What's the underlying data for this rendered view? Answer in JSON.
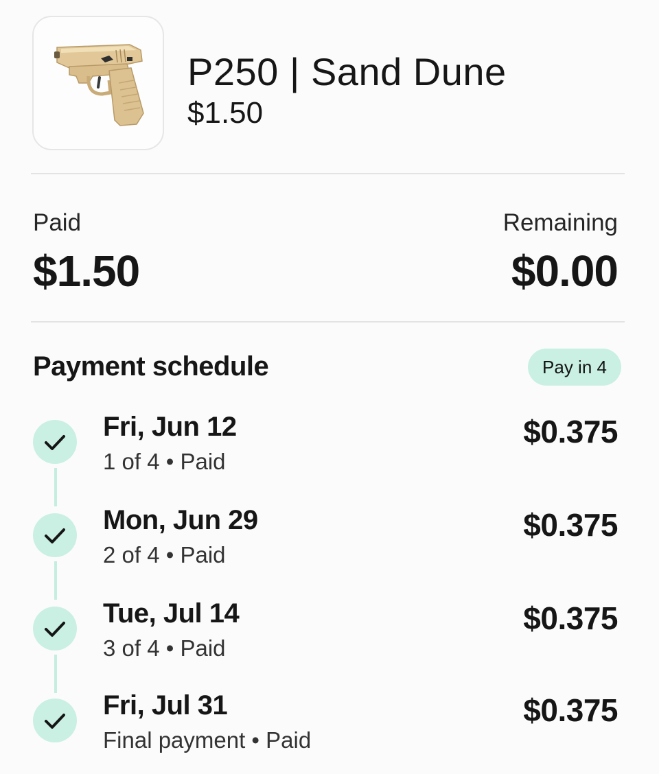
{
  "item": {
    "image_icon": "pistol-icon",
    "title": "P250 | Sand Dune",
    "price": "$1.50"
  },
  "summary": {
    "paid_label": "Paid",
    "paid_value": "$1.50",
    "remaining_label": "Remaining",
    "remaining_value": "$0.00"
  },
  "schedule": {
    "title": "Payment schedule",
    "plan_badge": "Pay in 4",
    "installments": [
      {
        "date": "Fri, Jun 12",
        "status": "1 of 4 • Paid",
        "amount": "$0.375",
        "icon": "check-icon"
      },
      {
        "date": "Mon, Jun 29",
        "status": "2 of 4 • Paid",
        "amount": "$0.375",
        "icon": "check-icon"
      },
      {
        "date": "Tue, Jul 14",
        "status": "3 of 4 • Paid",
        "amount": "$0.375",
        "icon": "check-icon"
      },
      {
        "date": "Fri, Jul 31",
        "status": "Final payment • Paid",
        "amount": "$0.375",
        "icon": "check-icon"
      }
    ]
  },
  "colors": {
    "accent_mint": "#c9f0e3",
    "text": "#161616",
    "divider": "#e3e3e3"
  }
}
